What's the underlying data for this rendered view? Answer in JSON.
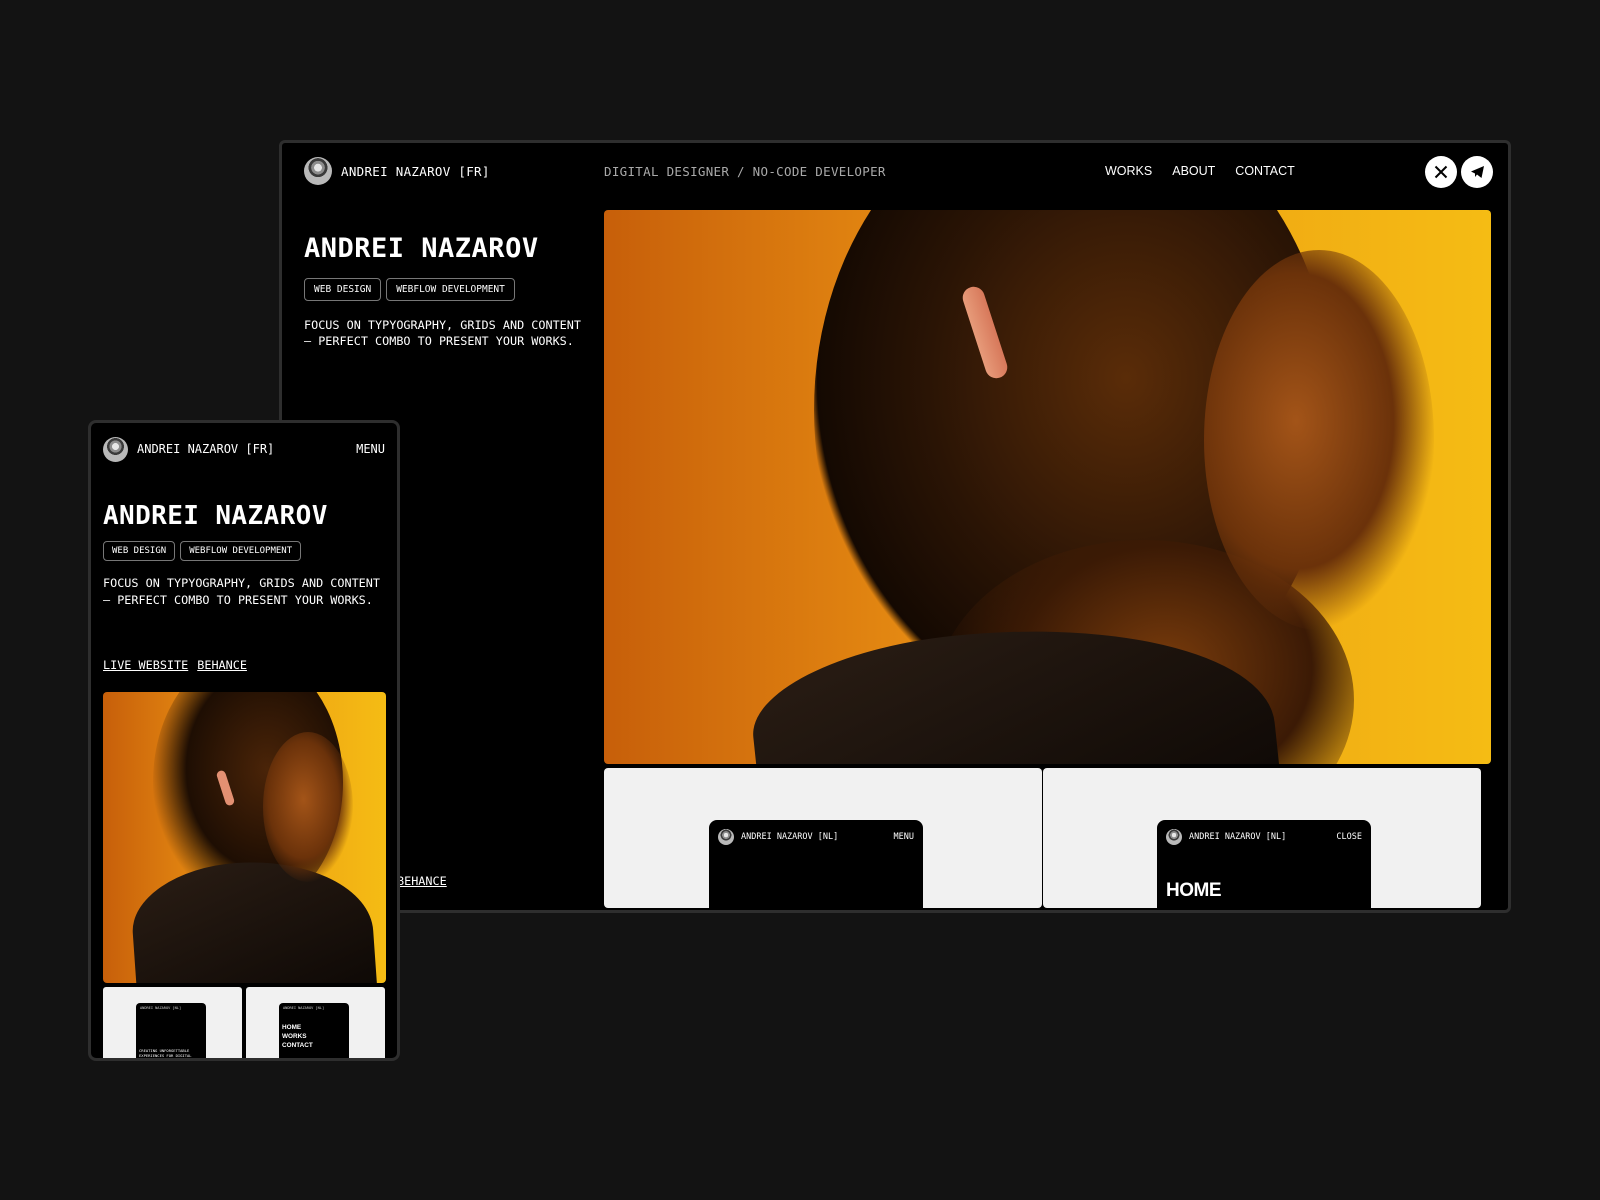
{
  "desktop": {
    "brand": "ANDREI NAZAROV [FR]",
    "role": "DIGITAL DESIGNER / NO-CODE DEVELOPER",
    "nav": [
      "WORKS",
      "ABOUT",
      "CONTACT"
    ],
    "social": [
      "x-icon",
      "telegram-icon"
    ],
    "title": "ANDREI NAZAROV",
    "tags": [
      "WEB DESIGN",
      "WEBFLOW DEVELOPMENT"
    ],
    "description": "FOCUS ON TYPYOGRAPHY, GRIDS AND CONTENT — PERFECT COMBO TO PRESENT YOUR WORKS.",
    "partial_link": "BEHANCE",
    "previews": [
      {
        "brand": "ANDREI NAZAROV [NL]",
        "action": "MENU"
      },
      {
        "brand": "ANDREI NAZAROV [NL]",
        "action": "CLOSE",
        "heading": "HOME"
      }
    ]
  },
  "mobile": {
    "brand": "ANDREI NAZAROV [FR]",
    "menu": "MENU",
    "title": "ANDREI NAZAROV",
    "tags": [
      "WEB DESIGN",
      "WEBFLOW DEVELOPMENT"
    ],
    "description": "FOCUS ON TYPYOGRAPHY, GRIDS AND CONTENT — PERFECT COMBO TO PRESENT YOUR WORKS.",
    "links": [
      "LIVE WEBSITE",
      "BEHANCE"
    ],
    "previews": [
      {
        "bar": "ANDREI NAZAROV [NL]",
        "action": "MENU",
        "text": "CREATING UNFORGETTABLE EXPERIENCES FOR DIGITAL PRODUCTS"
      },
      {
        "bar": "ANDREI NAZAROV [NL]",
        "action": "CLOSE",
        "nav": [
          "HOME",
          "WORKS",
          "CONTACT"
        ]
      }
    ]
  }
}
